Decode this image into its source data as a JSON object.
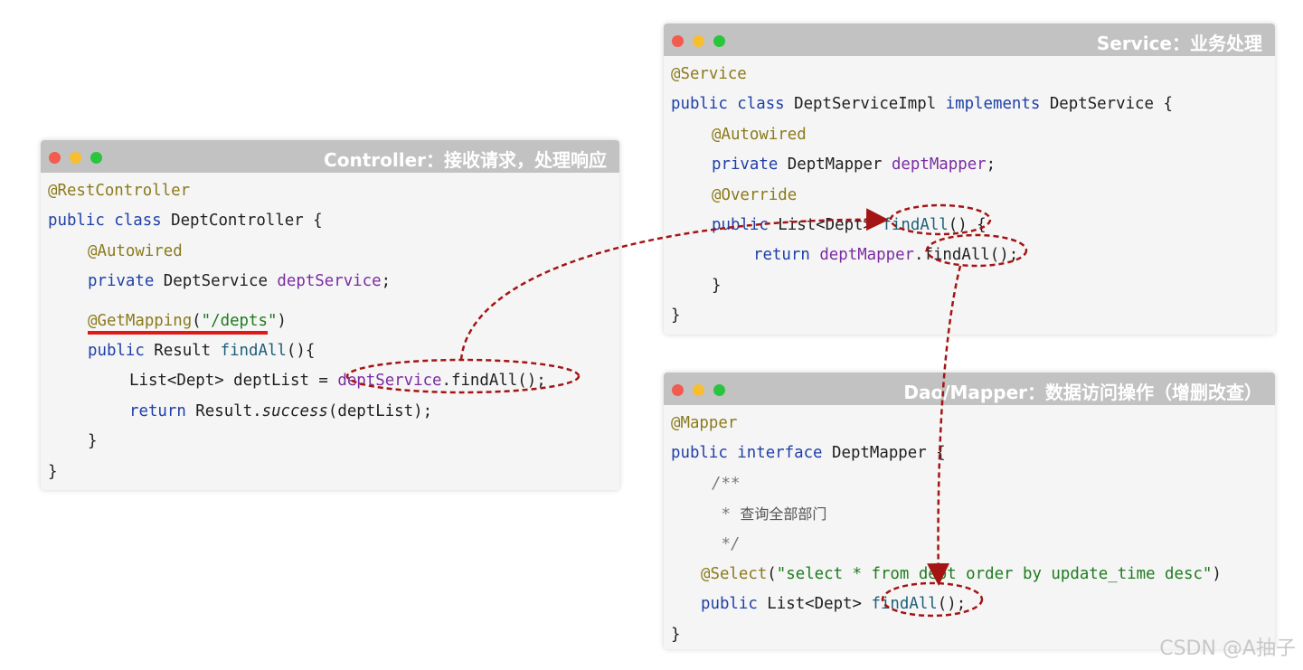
{
  "colors": {
    "annotation": "#8a7a1c",
    "keyword": "#1e3fa8",
    "field": "#7b2ca2",
    "string": "#1f7a1f",
    "arrow": "#a41414",
    "underline": "#e01818"
  },
  "controller": {
    "title": "Controller：接收请求，处理响应",
    "lines": {
      "l1": "@RestController",
      "l2_kw": "public class",
      "l2_rest": " DeptController {",
      "l3": "@Autowired",
      "l4_kw": "private",
      "l4_type": " DeptService ",
      "l4_field": "deptService",
      "l4_end": ";",
      "l5_ann": "@GetMapping",
      "l5_open": "(",
      "l5_str": "\"/depts\"",
      "l5_close": ")",
      "l6_kw": "public",
      "l6_type": " Result ",
      "l6_meth": "findAll",
      "l6_end": "(){",
      "l7_a": "List<Dept> deptList = ",
      "l7_field": "deptService",
      "l7_b": ".findAll();",
      "l8_kw": "return",
      "l8_a": " Result.",
      "l8_it": "success",
      "l8_b": "(deptList);",
      "l9": "}",
      "l10": "}"
    }
  },
  "service": {
    "title": "Service：业务处理",
    "lines": {
      "l1": "@Service",
      "l2_kw": "public class",
      "l2_mid": " DeptServiceImpl ",
      "l2_kw2": "implements",
      "l2_end": " DeptService {",
      "l3": "@Autowired",
      "l4_kw": "private",
      "l4_type": " DeptMapper ",
      "l4_field": "deptMapper",
      "l4_end": ";",
      "l5": "@Override",
      "l6_kw": "public",
      "l6_type": " List<Dept> ",
      "l6_meth": "findAll",
      "l6_end": "() {",
      "l7_kw": "return",
      "l7_sp": " ",
      "l7_field": "deptMapper",
      "l7_end": ".findAll();",
      "l8": "}",
      "l9": "}"
    }
  },
  "mapper": {
    "title": "Dao/Mapper：数据访问操作（增删改查）",
    "lines": {
      "l1": "@Mapper",
      "l2_kw": "public interface",
      "l2_rest": " DeptMapper {",
      "l3": "/**",
      "l4_star": " * ",
      "l4_text": "查询全部部门",
      "l5": " */",
      "l6_ann": "@Select",
      "l6_open": "(",
      "l6_str": "\"select * from dept order by update_time desc\"",
      "l6_close": ")",
      "l7_kw": "public",
      "l7_type": " List<Dept> ",
      "l7_meth": "findAll",
      "l7_end": "();",
      "l8": "}"
    }
  },
  "watermark": "CSDN @A抽子"
}
